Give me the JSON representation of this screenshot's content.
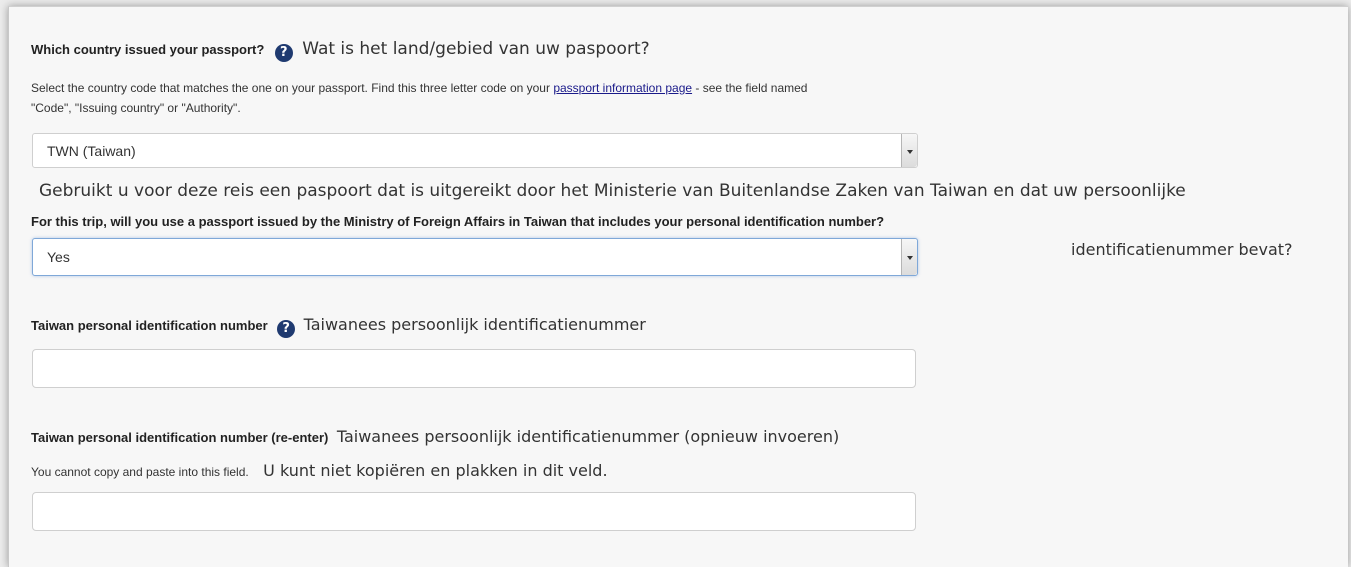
{
  "passport_country": {
    "label": "Which country issued your passport?",
    "label_nl": "Wat is het land/gebied van uw paspoort?",
    "help_icon": "question-circle-icon",
    "hint_line1_pre": "Select the country code that matches the one on your passport.  Find this three letter code on your ",
    "hint_link": "passport information page",
    "hint_line1_post": " - see the field named",
    "hint_line2": "\"Code\", \"Issuing country\" or \"Authority\".",
    "selected_value": "TWN (Taiwan)"
  },
  "mofa_passport": {
    "question_nl_line1": "Gebruikt u voor deze reis een paspoort dat is uitgereikt door het Ministerie van Buitenlandse Zaken van Taiwan en dat uw persoonlijke",
    "label": "For this trip, will you use a passport issued by the Ministry of Foreign Affairs in Taiwan that includes your personal identification number?",
    "question_nl_line2": "identificatienummer bevat?",
    "selected_value": "Yes"
  },
  "personal_id": {
    "label": "Taiwan personal identification number",
    "label_nl": "Taiwanees persoonlijk identificatienummer",
    "help_icon": "question-circle-icon",
    "value": ""
  },
  "personal_id_reenter": {
    "label": "Taiwan personal identification number (re-enter)",
    "label_nl": "Taiwanees persoonlijk identificatienummer (opnieuw invoeren)",
    "hint": "You cannot copy and paste into this field.",
    "hint_nl": "U kunt niet kopiëren en plakken in dit veld.",
    "value": ""
  },
  "colors": {
    "help_icon": "#1f3a70",
    "focus_border": "#7fa8d8",
    "link": "#1a1a8a"
  }
}
